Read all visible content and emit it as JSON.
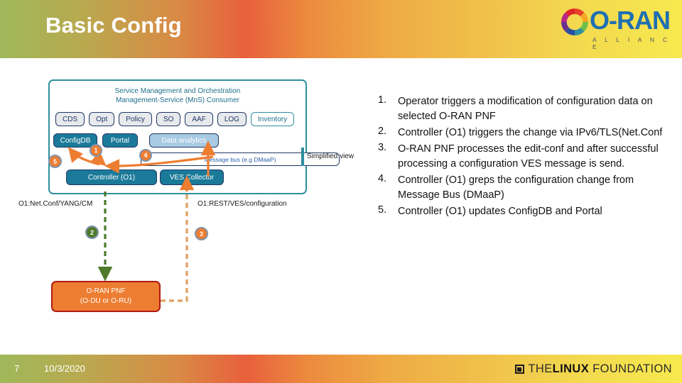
{
  "header": {
    "title": "Basic Config",
    "logo_word": "O-RAN",
    "logo_sub": "A L L I A N C E"
  },
  "footer": {
    "page_number": "7",
    "date": "10/3/2020",
    "lf_the": "THE",
    "lf_linux": "LINUX",
    "lf_foundation": "FOUNDATION"
  },
  "diagram": {
    "smo_title_line1": "Service Management and Orchestration",
    "smo_title_line2": "Management-Service (MnS) Consumer",
    "pills": [
      {
        "label": "CDS"
      },
      {
        "label": "Opt"
      },
      {
        "label": "Policy"
      },
      {
        "label": "SO"
      },
      {
        "label": "AAF"
      },
      {
        "label": "LOG"
      },
      {
        "label": "Inventory"
      }
    ],
    "boxes": {
      "configdb": "ConfigDB",
      "portal": "Portal",
      "data_analytics": "Data analytics",
      "message_bus": "Message bus (e.g DMaaP)",
      "controller": "Controller (O1)",
      "ves_collector": "VES Collector"
    },
    "steps": {
      "s1": "1",
      "s2": "2",
      "s3": "3",
      "s4": "4",
      "s5": "5"
    },
    "interface_left": "O1:Net.Conf/YANG/CM",
    "interface_right": "O1:REST/VES/configuration",
    "simplified_view": "Simplified view",
    "pnf_line1": "O-RAN PNF",
    "pnf_line2": "(O-DU or O-RU)"
  },
  "steps_list": [
    {
      "num": "1.",
      "text": "Operator triggers a modification of configuration data on selected O-RAN PNF"
    },
    {
      "num": "2.",
      "text": "Controller (O1) triggers the change via IPv6/TLS(Net.Conf"
    },
    {
      "num": "3.",
      "text": "O-RAN PNF processes the edit-conf and after successful processing a configuration VES message is send."
    },
    {
      "num": "4.",
      "text": "Controller (O1) greps the configuration change from Message Bus (DMaaP)"
    },
    {
      "num": "5.",
      "text": "Controller (O1) updates ConfigDB and Portal"
    }
  ],
  "colors": {
    "teal": "#1b7a99",
    "orange": "#ED7D31",
    "green": "#4E7A2A",
    "dark_blue": "#1f3864",
    "pnf_border": "#b11a13"
  }
}
